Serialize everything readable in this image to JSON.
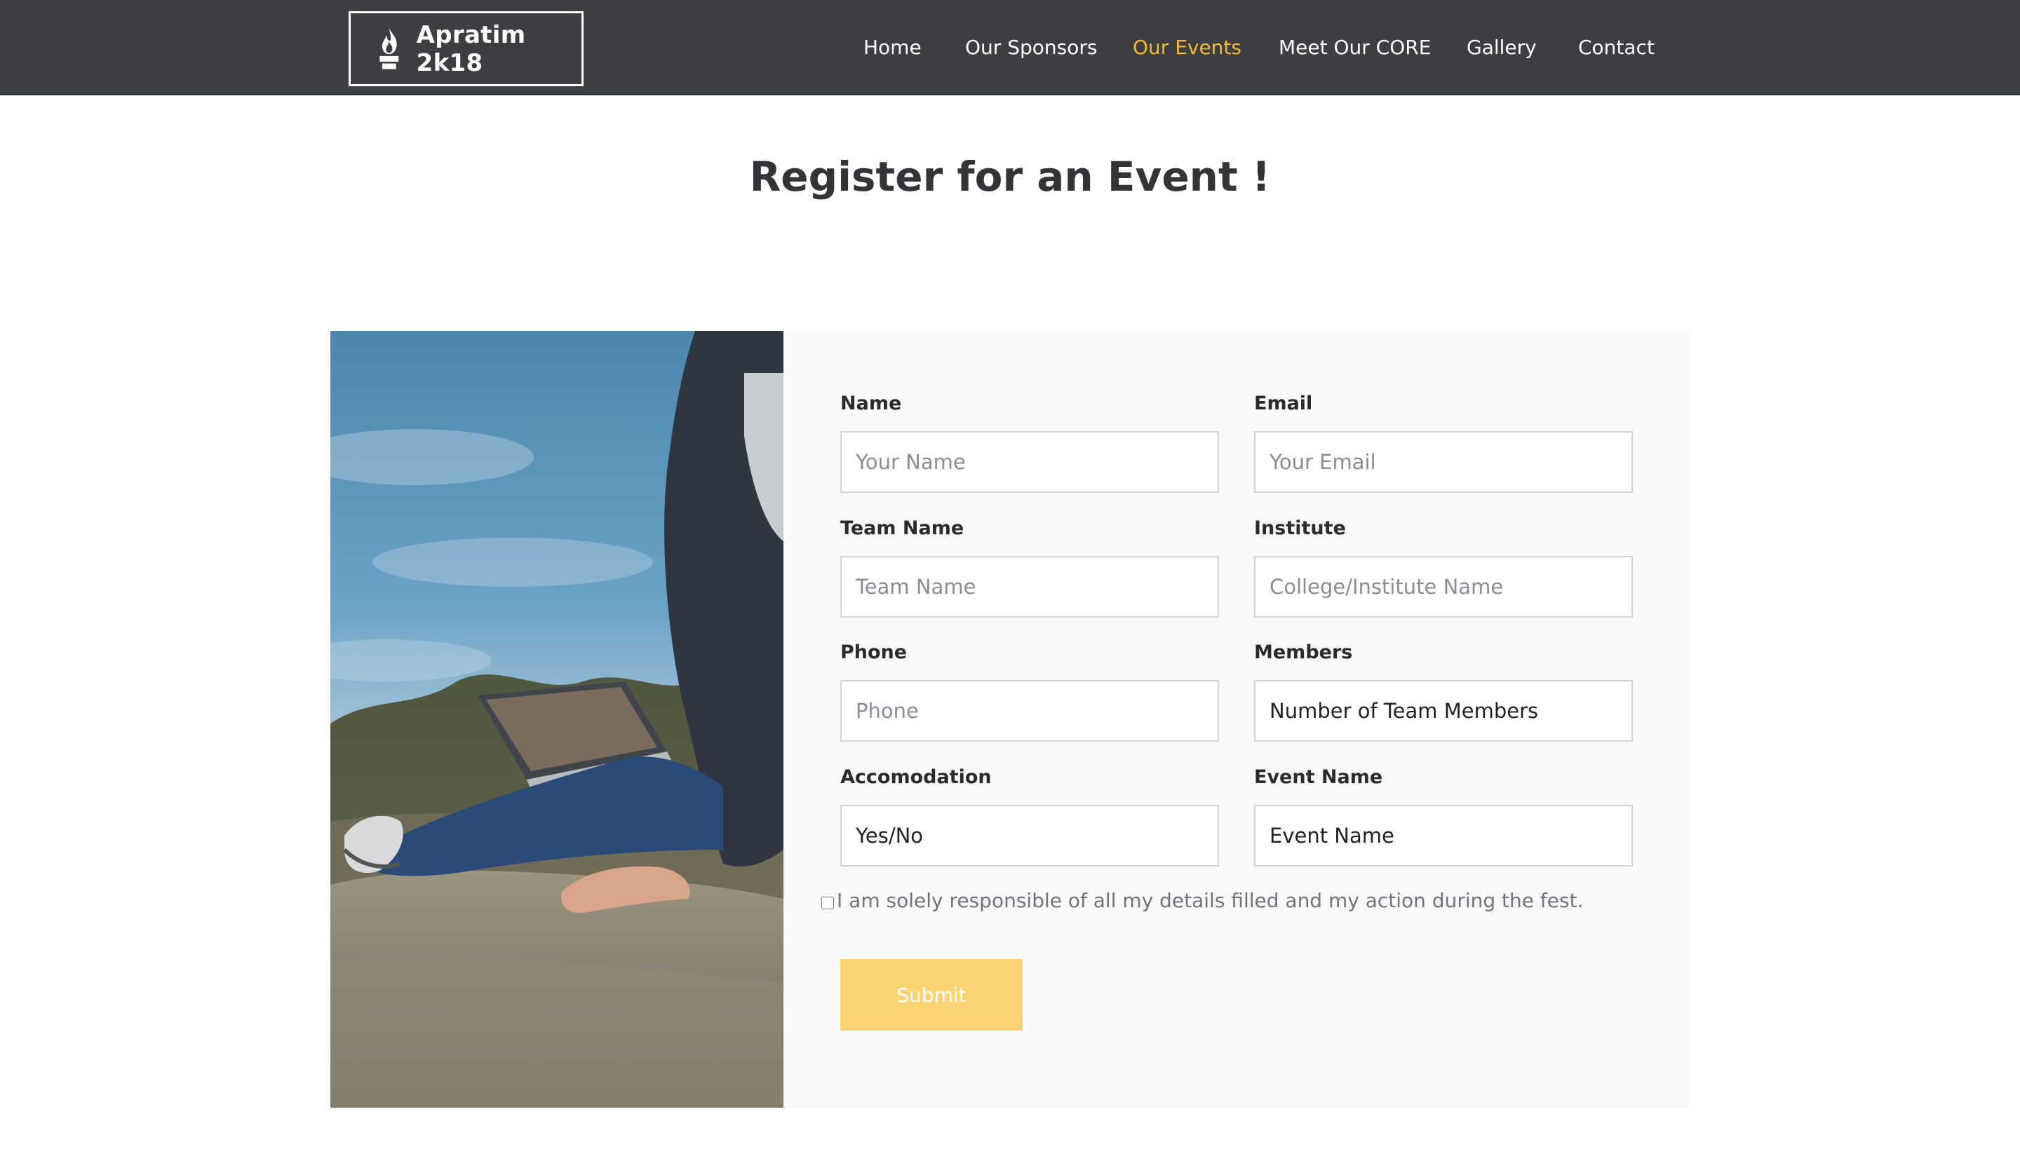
{
  "brand": {
    "name": "Apratim 2k18",
    "logo_icon": "flame-logo-icon",
    "logo_lettering": "APRATIM 2018"
  },
  "nav": {
    "items": [
      {
        "label": "Home",
        "active": false
      },
      {
        "label": "Our Sponsors",
        "active": false
      },
      {
        "label": "Our Events",
        "active": true
      },
      {
        "label": "Meet Our CORE",
        "active": false
      },
      {
        "label": "Gallery",
        "active": false
      },
      {
        "label": "Contact",
        "active": false
      }
    ],
    "active_color": "#f5b82e"
  },
  "page": {
    "title": "Register for an Event !"
  },
  "form": {
    "name": {
      "label": "Name",
      "placeholder": "Your Name"
    },
    "email": {
      "label": "Email",
      "placeholder": "Your Email"
    },
    "team_name": {
      "label": "Team Name",
      "placeholder": "Team Name"
    },
    "institute": {
      "label": "Institute",
      "placeholder": "College/Institute Name"
    },
    "phone": {
      "label": "Phone",
      "placeholder": "Phone"
    },
    "members": {
      "label": "Members",
      "value": "Number of Team Members"
    },
    "accomodation": {
      "label": "Accomodation",
      "value": "Yes/No"
    },
    "event_name": {
      "label": "Event Name",
      "value": "Event Name"
    },
    "consent_text": "I am solely responsible of all my details filled and my action during the fest.",
    "consent_checked": false,
    "submit_label": "Submit"
  },
  "colors": {
    "topbar": "#3d3e42",
    "accent": "#f5b82e",
    "submit_bg": "#fcd371",
    "card_bg": "#f9f9f9"
  }
}
